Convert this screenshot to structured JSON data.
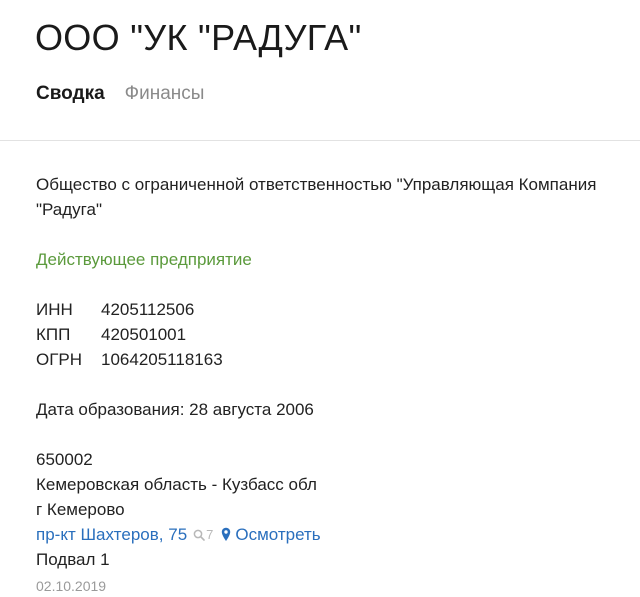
{
  "header": {
    "title": "ООО \"УК \"РАДУГА\"",
    "tabs": [
      {
        "label": "Сводка",
        "active": true
      },
      {
        "label": "Финансы",
        "active": false
      }
    ]
  },
  "summary": {
    "full_name": "Общество с ограниченной ответственностью \"Управляющая Компания \"Радуга\"",
    "status": "Действующее предприятие",
    "codes": [
      {
        "label": "ИНН",
        "value": "4205112506"
      },
      {
        "label": "КПП",
        "value": "420501001"
      },
      {
        "label": "ОГРН",
        "value": "1064205118163"
      }
    ],
    "founded": "Дата образования: 28 августа 2006",
    "address": {
      "postal_code": "650002",
      "region": "Кемеровская область - Кузбасс обл",
      "city": "г Кемерово",
      "street": "пр-кт Шахтеров, 75",
      "search_count": "7",
      "view_label": "Осмотреть",
      "premises": "Подвал 1"
    },
    "date": "02.10.2019"
  },
  "colors": {
    "status": "#5b9a3c",
    "link": "#2a6fbd",
    "muted": "#8a8a8a"
  },
  "icons": {
    "search": "search-icon",
    "location": "map-pin-icon"
  }
}
